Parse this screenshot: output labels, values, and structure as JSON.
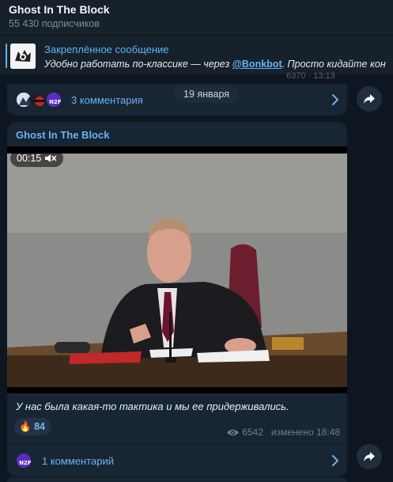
{
  "channel": {
    "title": "Ghost In The Block",
    "subscribers": "55 430 подписчиков"
  },
  "pinned": {
    "label": "Закреплённое сообщение",
    "text_before": "Удобно работать по-классике — через ",
    "mention": "@Bonkbot",
    "text_after": ".   Просто кидайте кон"
  },
  "previous_post": {
    "comments_label": "3 комментария",
    "partial_meta": "6370 · 13:13"
  },
  "date_divider": "19 января",
  "post": {
    "author": "Ghost In The Block",
    "video": {
      "duration": "00:15",
      "muted": true
    },
    "caption": "У нас была какая-то тактика и мы ее придерживались.",
    "reaction": {
      "emoji": "🔥",
      "count": "84"
    },
    "views": "6542",
    "edited": "изменено 18:48",
    "comments_label": "1 комментарий"
  },
  "colors": {
    "accent": "#6ab3f3",
    "background": "#0e1621",
    "bubble": "#182533"
  },
  "icons": [
    "pin-thumbnail-icon",
    "chevron-right-icon",
    "share-arrow-icon",
    "mute-icon",
    "eye-icon"
  ]
}
